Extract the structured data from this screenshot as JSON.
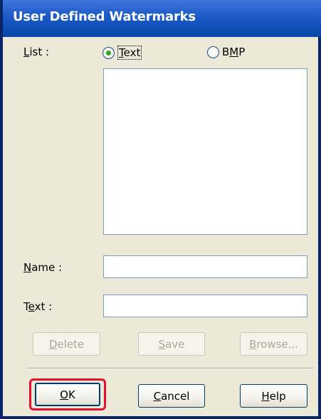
{
  "window": {
    "title": "User Defined Watermarks"
  },
  "list": {
    "label_prefix": "",
    "label_underlined": "L",
    "label_suffix": "ist :",
    "items": []
  },
  "radios": {
    "text": {
      "label_underlined": "T",
      "label_suffix": "ext",
      "checked": true
    },
    "bmp": {
      "label_prefix": "B",
      "label_underlined": "M",
      "label_suffix": "P",
      "checked": false
    }
  },
  "name_field": {
    "label_underlined": "N",
    "label_suffix": "ame :",
    "value": ""
  },
  "text_field": {
    "label_prefix": "T",
    "label_underlined": "e",
    "label_suffix": "xt :",
    "value": ""
  },
  "buttons": {
    "delete": {
      "underlined": "D",
      "rest": "elete",
      "enabled": false
    },
    "save": {
      "underlined": "S",
      "rest": "ave",
      "enabled": false
    },
    "browse": {
      "underlined": "B",
      "rest": "rowse...",
      "enabled": false
    },
    "ok": {
      "underlined": "O",
      "rest": "K",
      "enabled": true
    },
    "cancel": {
      "underlined": "C",
      "rest": "ancel",
      "enabled": true
    },
    "help": {
      "underlined": "H",
      "rest": "elp",
      "enabled": true
    }
  },
  "colors": {
    "titlebar": "#1f5cc7",
    "dialog_bg": "#ece9d8",
    "highlight": "#e2132d",
    "radio_dot": "#3ba02a"
  }
}
